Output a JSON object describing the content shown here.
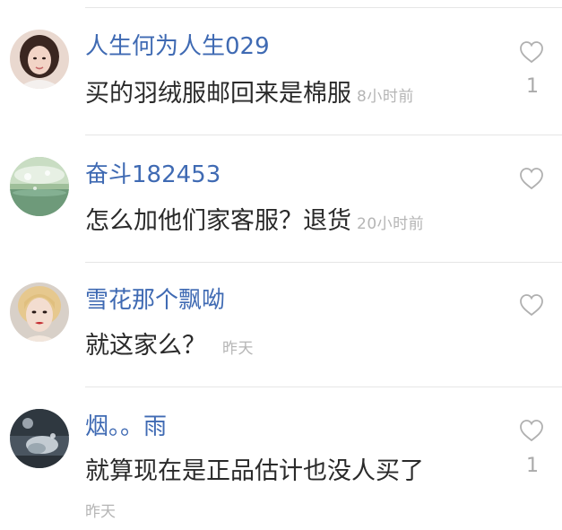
{
  "comments": [
    {
      "username": "人生何为人生029",
      "text": "买的羽绒服邮回来是棉服",
      "time": "8小时前",
      "likes": "1",
      "avatar": "female-user-avatar"
    },
    {
      "username": "奋斗182453",
      "text": "怎么加他们家客服？退货",
      "time": "20小时前",
      "likes": "",
      "avatar": "landscape-avatar"
    },
    {
      "username": "雪花那个飘呦",
      "text": "就这家么？",
      "time": "昨天",
      "likes": "",
      "avatar": "female-user-avatar"
    },
    {
      "username": "烟。。雨",
      "text": "就算现在是正品估计也没人买了",
      "time": "昨天",
      "likes": "1",
      "avatar": "night-scene-avatar"
    }
  ],
  "colors": {
    "username": "#3f6ab3",
    "text": "#2a2a2a",
    "meta": "#b5b5b5",
    "divider": "#e6e6e6"
  }
}
